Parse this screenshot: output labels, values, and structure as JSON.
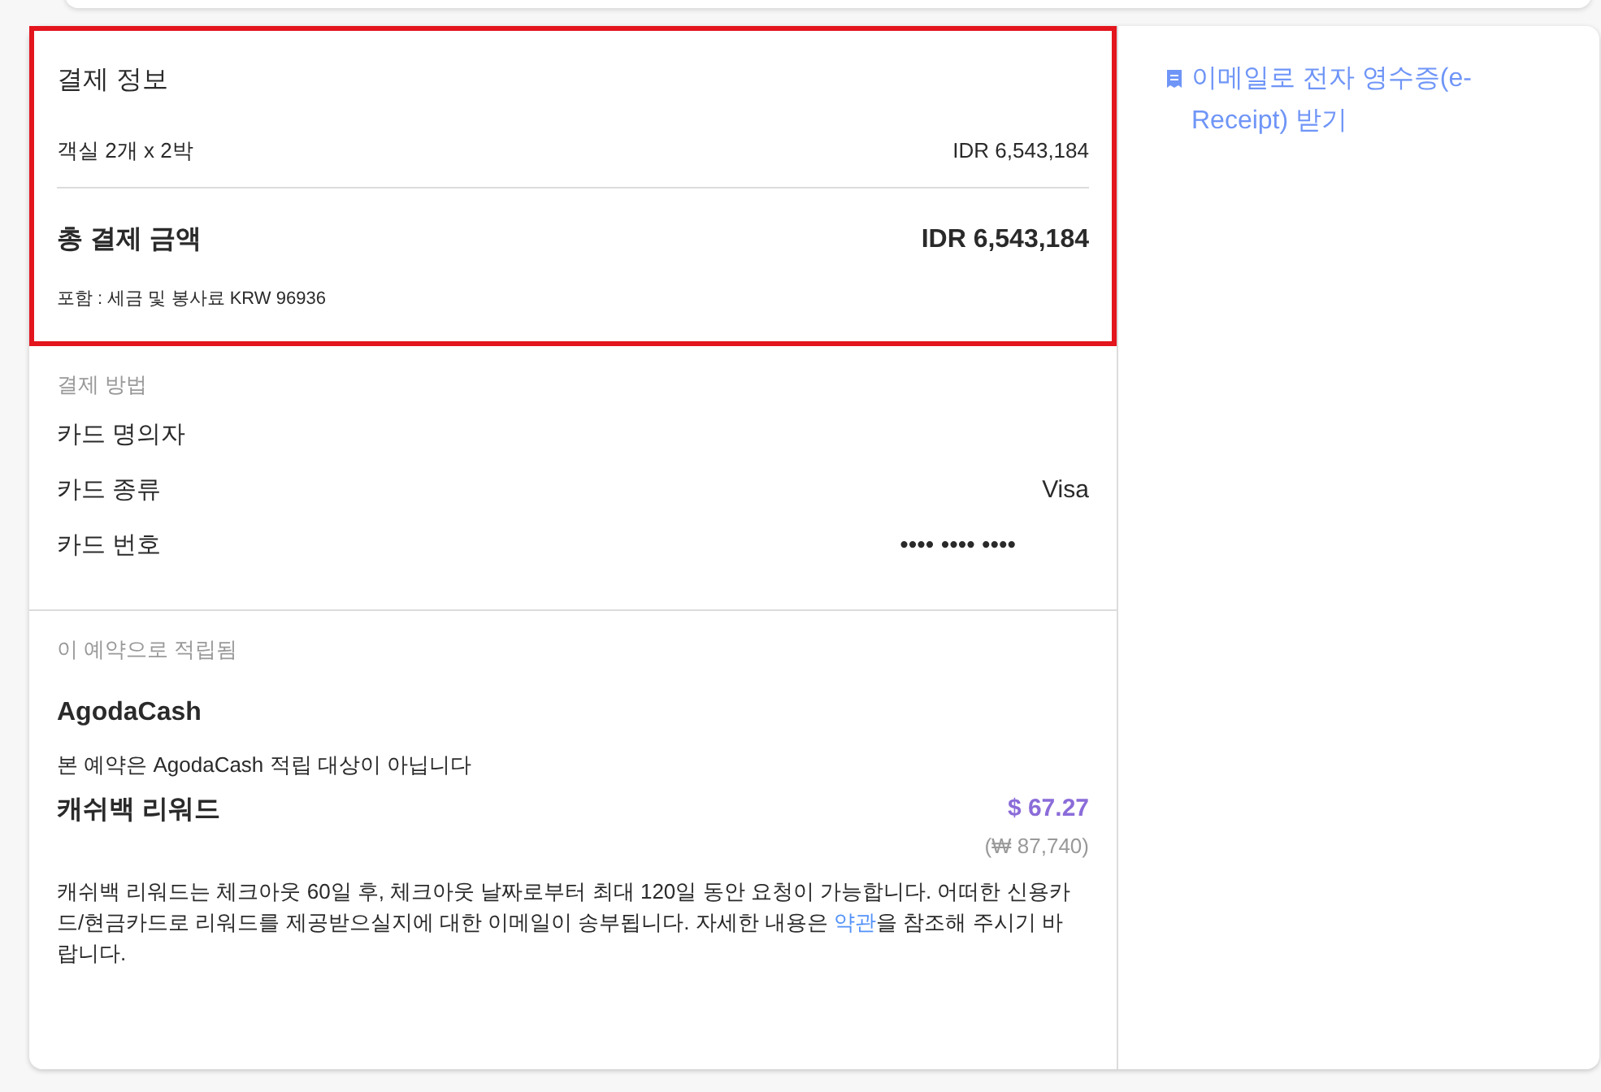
{
  "payment_info": {
    "title": "결제 정보",
    "highlighted": true,
    "line_item": {
      "label": "객실 2개 x 2박",
      "value": "IDR 6,543,184"
    },
    "total": {
      "label": "총 결제 금액",
      "value": "IDR 6,543,184"
    },
    "note": "포함 : 세금 및 봉사료 KRW 96936"
  },
  "payment_method": {
    "title": "결제 방법",
    "rows": [
      {
        "label": "카드 명의자"
      },
      {
        "label": "카드 종류",
        "value": "Visa"
      },
      {
        "label": "카드 번호",
        "value": "•••• •••• ••••"
      }
    ]
  },
  "earned": {
    "title": "이 예약으로 적립됨",
    "agodacash_title": "AgodaCash",
    "agodacash_note": "본 예약은 AgodaCash 적립 대상이 아닙니다",
    "cashback_title": "캐쉬백 리워드",
    "cashback_value": "$ 67.27",
    "cashback_converted": "(₩ 87,740)",
    "description_before": "캐쉬백 리워드는 체크아웃 60일 후, 체크아웃 날짜로부터 최대 120일 동안 요청이 가능합니다. 어떠한 신용카드/현금카드로 리워드를 제공받으실지에 대한 이메일이 송부됩니다. 자세한 내용은 ",
    "terms_link": "약관",
    "description_after": "을 참조해 주시기 바랍니다."
  },
  "sidebar": {
    "receipt_link": "이메일로 전자 영수증(e-Receipt) 받기"
  }
}
